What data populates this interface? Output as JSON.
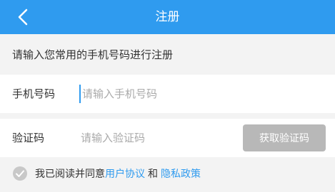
{
  "header": {
    "title": "注册",
    "back_icon": "chevron-left-icon",
    "background_color": "#2f9bef"
  },
  "hint": "请输入您常用的手机号码进行注册",
  "phone": {
    "label": "手机号码",
    "placeholder": "请输入手机号码",
    "value": ""
  },
  "code": {
    "label": "验证码",
    "placeholder": "请输入验证码",
    "value": "",
    "button_label": "获取验证码",
    "button_color": "#b8b8b8"
  },
  "agreement": {
    "checkbox_icon": "check-circle-icon",
    "checked": false,
    "text": "我已阅读并同意",
    "link_user": "用户协议",
    "conjunction": "和",
    "link_privacy": "隐私政策",
    "link_color": "#2f9bef"
  }
}
